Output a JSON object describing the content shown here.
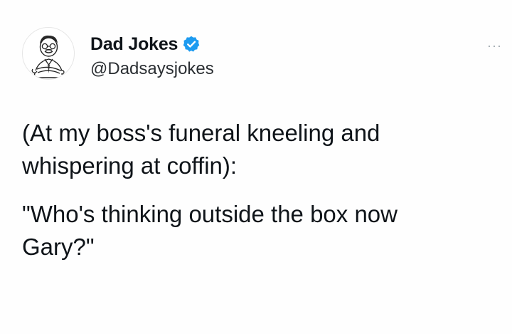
{
  "tweet": {
    "display_name": "Dad Jokes",
    "handle": "@Dadsaysjokes",
    "verified": true,
    "more_label": "···",
    "paragraphs": [
      "(At my boss's funeral kneeling and\nwhispering at coffin):",
      "\"Who's thinking outside the box now\nGary?\""
    ]
  },
  "icons": {
    "avatar": "cartoon-man-avatar",
    "verified": "verified-badge-icon",
    "more": "more-options-icon"
  },
  "colors": {
    "verified_badge": "#1d9bf0",
    "text": "#0f1419",
    "more_dots": "#9aa3ab"
  }
}
